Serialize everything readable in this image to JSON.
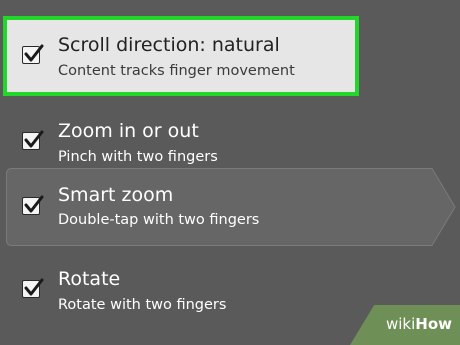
{
  "settings": [
    {
      "title": "Scroll direction: natural",
      "subtitle": "Content tracks finger movement",
      "checked": true
    },
    {
      "title": "Zoom in or out",
      "subtitle": "Pinch with two fingers",
      "checked": true
    },
    {
      "title": "Smart zoom",
      "subtitle": "Double-tap with two fingers",
      "checked": true
    },
    {
      "title": "Rotate",
      "subtitle": "Rotate with two fingers",
      "checked": true
    }
  ],
  "watermark": {
    "prefix": "wiki",
    "bold": "How"
  },
  "colors": {
    "background": "#5a5a5a",
    "highlight_border": "#22d62a",
    "highlight_fill": "#e6e6e6",
    "watermark_bg": "#6e8f56"
  }
}
